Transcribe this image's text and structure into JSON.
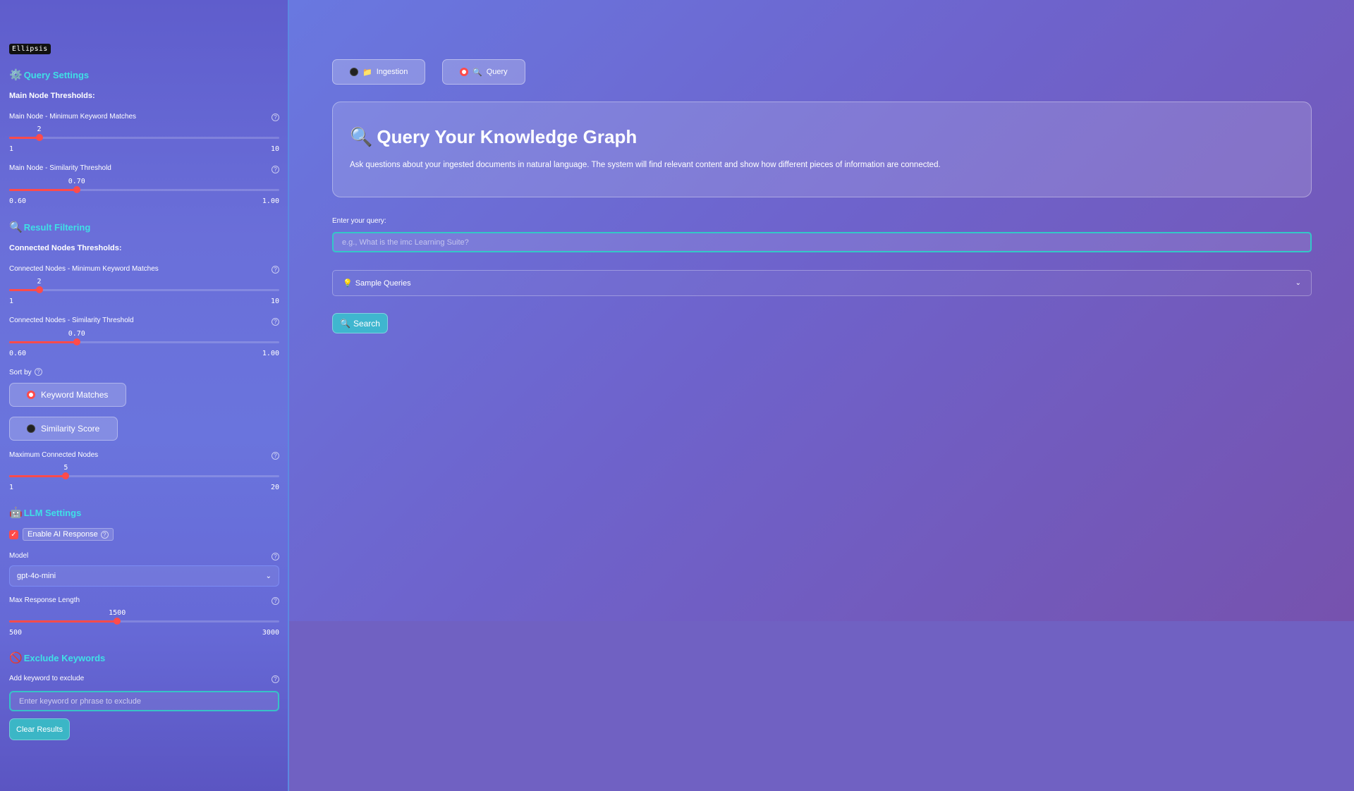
{
  "sidebar": {
    "badge": "Ellipsis",
    "query_settings": {
      "title": "Query Settings",
      "subheading": "Main Node Thresholds:",
      "keyword_slider": {
        "label": "Main Node - Minimum Keyword Matches",
        "value": "2",
        "min": "1",
        "max": "10",
        "fraction": 0.111
      },
      "similarity_slider": {
        "label": "Main Node - Similarity Threshold",
        "value": "0.70",
        "min": "0.60",
        "max": "1.00",
        "fraction": 0.25
      }
    },
    "result_filtering": {
      "title": "Result Filtering",
      "subheading": "Connected Nodes Thresholds:",
      "keyword_slider": {
        "label": "Connected Nodes - Minimum Keyword Matches",
        "value": "2",
        "min": "1",
        "max": "10",
        "fraction": 0.111
      },
      "similarity_slider": {
        "label": "Connected Nodes - Similarity Threshold",
        "value": "0.70",
        "min": "0.60",
        "max": "1.00",
        "fraction": 0.25
      },
      "sort_label": "Sort by",
      "sort_options": [
        {
          "label": "Keyword Matches",
          "selected": true
        },
        {
          "label": "Similarity Score",
          "selected": false
        }
      ],
      "max_nodes_slider": {
        "label": "Maximum Connected Nodes",
        "value": "5",
        "min": "1",
        "max": "20",
        "fraction": 0.21
      }
    },
    "llm_settings": {
      "title": "LLM Settings",
      "enable_label": "Enable AI Response",
      "enable_checked": true,
      "model_label": "Model",
      "model_value": "gpt-4o-mini",
      "length_slider": {
        "label": "Max Response Length",
        "value": "1500",
        "min": "500",
        "max": "3000",
        "fraction": 0.4
      }
    },
    "exclude_keywords": {
      "title": "Exclude Keywords",
      "input_label": "Add keyword to exclude",
      "input_placeholder": "Enter keyword or phrase to exclude",
      "clear_button": "Clear Results"
    }
  },
  "main": {
    "tabs": [
      {
        "label": "Ingestion",
        "emoji": "📁",
        "selected": false
      },
      {
        "label": "Query",
        "emoji": "🔍",
        "selected": true
      }
    ],
    "hero": {
      "title": "Query Your Knowledge Graph",
      "description": "Ask questions about your ingested documents in natural language. The system will find relevant content and show how different pieces of information are connected."
    },
    "query_label": "Enter your query:",
    "query_placeholder": "e.g., What is the imc Learning Suite?",
    "sample_queries": "Sample Queries",
    "search_button": "Search"
  },
  "colors": {
    "accent": "#ff4b4b",
    "heading": "#3fe0e6",
    "teal_button": "#3fb6cf"
  }
}
